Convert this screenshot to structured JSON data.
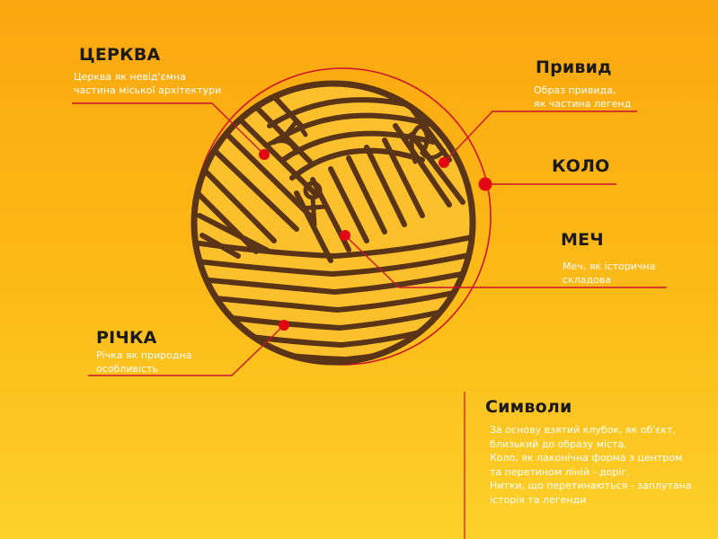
{
  "colors": {
    "background_top": "#fba70f",
    "background_bottom": "#fdd02a",
    "ball_fill": "#fcc02c",
    "ball_stroke": "#5a3416",
    "accent_red": "#e30613",
    "leader_line": "#c8142c",
    "title_text": "#1a1a1a",
    "description_text": "#ffffff"
  },
  "labels": {
    "church": {
      "title": "ЦЕРКВА",
      "description": "Церква як невід'ємна\nчастина міської архітектури"
    },
    "ghost": {
      "title": "Привид",
      "description": "Образ привида,\nяк частина легенд"
    },
    "circle": {
      "title": "КОЛО"
    },
    "sword": {
      "title": "МЕЧ",
      "description": "Меч, як історична\nскладова"
    },
    "river": {
      "title": "РІЧКА",
      "description": "Річка як природна\nособливість"
    }
  },
  "symbols": {
    "title": "Символи",
    "text": "За основу взятий клубок, як об'єкт,\nблизький до образу міста.\nКоло, як лаконічна форма з центром\nта перетином ліній - доріг.\nНитки, що перетинаються - заплутана\nісторія та легенди"
  }
}
